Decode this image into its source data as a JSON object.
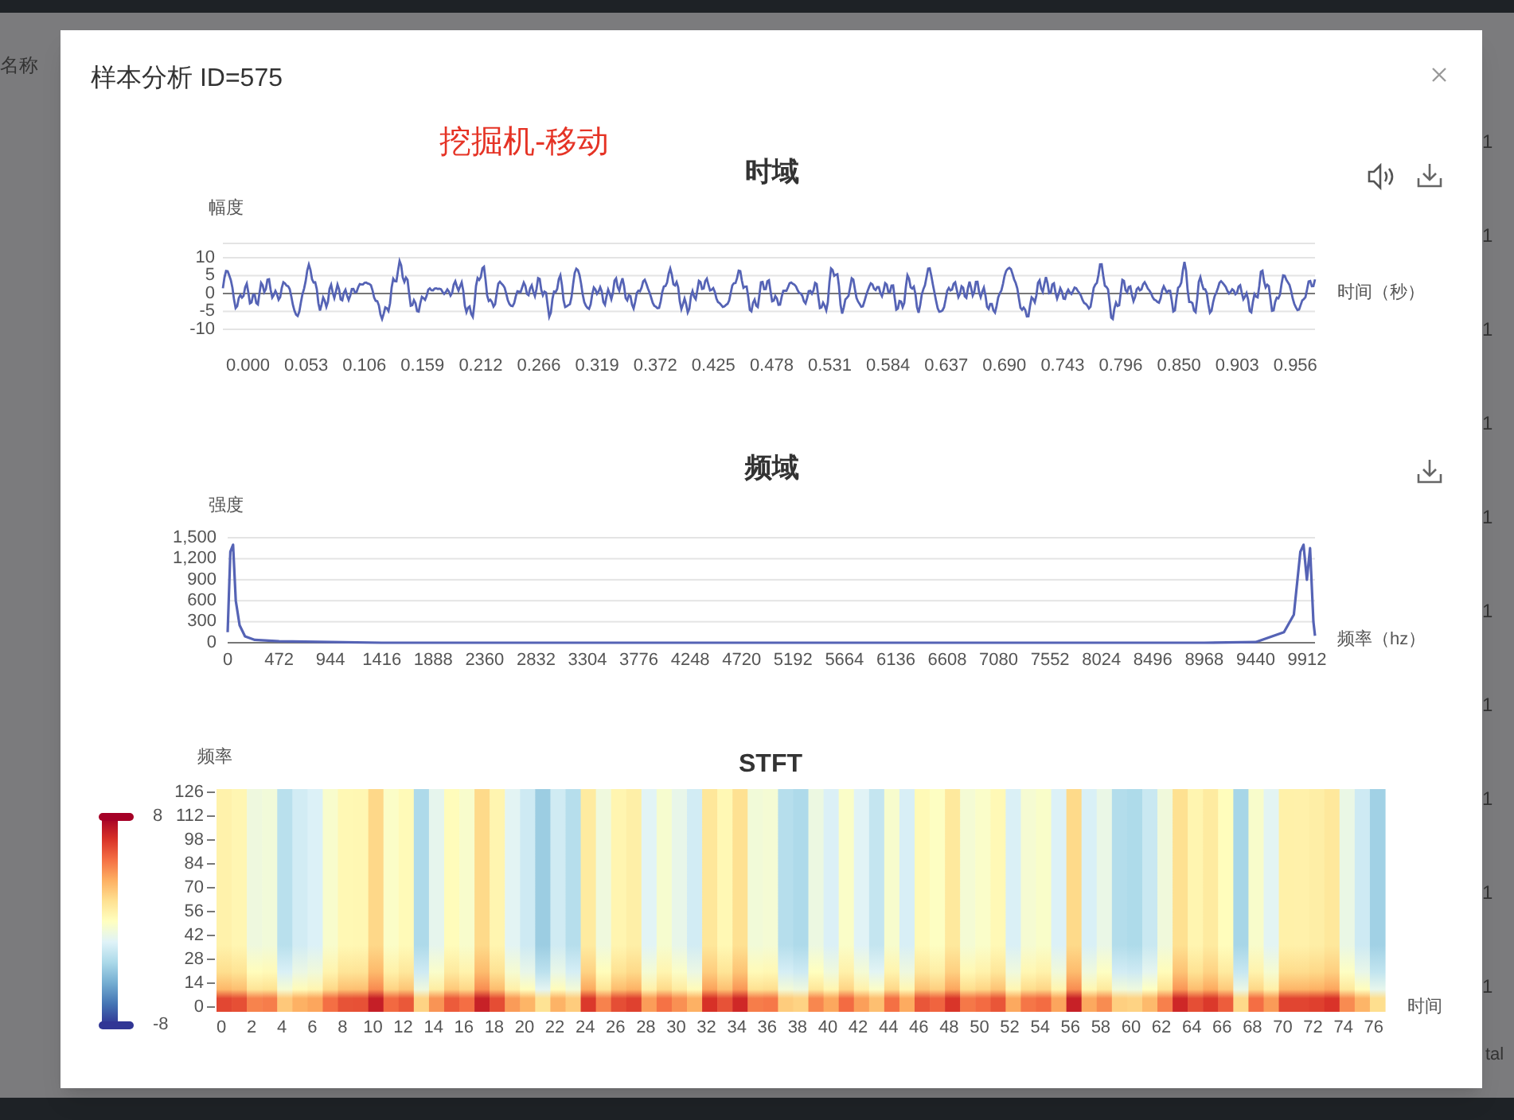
{
  "background": {
    "column_header": "名称",
    "column_values": [
      "1",
      "1",
      "1",
      "1",
      "1",
      "1",
      "1",
      "1",
      "1",
      "1"
    ],
    "footer": "tal"
  },
  "dialog": {
    "title": "样本分析 ID=575",
    "label": "挖掘机-移动",
    "time_chart": {
      "title": "时域",
      "ylabel": "幅度",
      "xlabel": "时间（秒）",
      "yticks": [
        "10",
        "5",
        "0",
        "-5",
        "-10"
      ],
      "xticks": [
        "0.000",
        "0.053",
        "0.106",
        "0.159",
        "0.212",
        "0.266",
        "0.319",
        "0.372",
        "0.425",
        "0.478",
        "0.531",
        "0.584",
        "0.637",
        "0.690",
        "0.743",
        "0.796",
        "0.850",
        "0.903",
        "0.956"
      ]
    },
    "freq_chart": {
      "chart_data": {
        "type": "line",
        "title": "频域",
        "ylabel": "强度",
        "xlabel": "频率（hz）",
        "x": [
          0,
          25,
          50,
          75,
          110,
          160,
          250,
          472,
          944,
          1416,
          1888,
          2360,
          2832,
          3304,
          3776,
          4248,
          4720,
          5192,
          5664,
          6136,
          6608,
          7080,
          7552,
          8024,
          8496,
          8968,
          9440,
          9700,
          9790,
          9850,
          9880,
          9910,
          9940,
          9970,
          9985
        ],
        "series": [
          {
            "color": "#5563b5",
            "values": [
              150,
              1300,
              1400,
              600,
              250,
              90,
              40,
              20,
              10,
              0,
              0,
              0,
              0,
              0,
              0,
              0,
              0,
              0,
              0,
              0,
              0,
              0,
              0,
              0,
              0,
              0,
              10,
              150,
              400,
              1300,
              1400,
              900,
              1350,
              300,
              100
            ]
          }
        ],
        "xlim": [
          0,
          9985
        ],
        "ylim": [
          0,
          1500
        ],
        "grid": true,
        "yticks": [
          {
            "value": 1500,
            "label": "1,500"
          },
          {
            "value": 1200,
            "label": "1,200"
          },
          900,
          600,
          300,
          0
        ],
        "xticks": [
          0,
          472,
          944,
          1416,
          1888,
          2360,
          2832,
          3304,
          3776,
          4248,
          4720,
          5192,
          5664,
          6136,
          6608,
          7080,
          7552,
          8024,
          8496,
          8968,
          9440,
          9912
        ]
      }
    },
    "stft_chart": {
      "title": "STFT",
      "ylabel": "频率",
      "xlabel": "时间",
      "yticks": [
        "126",
        "112",
        "98",
        "84",
        "70",
        "56",
        "42",
        "28",
        "14",
        "0"
      ],
      "xticks": [
        "0",
        "2",
        "4",
        "6",
        "8",
        "10",
        "12",
        "14",
        "16",
        "18",
        "20",
        "22",
        "24",
        "26",
        "28",
        "30",
        "32",
        "34",
        "36",
        "38",
        "40",
        "42",
        "44",
        "46",
        "48",
        "50",
        "52",
        "54",
        "56",
        "58",
        "60",
        "62",
        "64",
        "66",
        "68",
        "70",
        "72",
        "74",
        "76"
      ],
      "scale_max": "8",
      "scale_min": "-8"
    }
  }
}
